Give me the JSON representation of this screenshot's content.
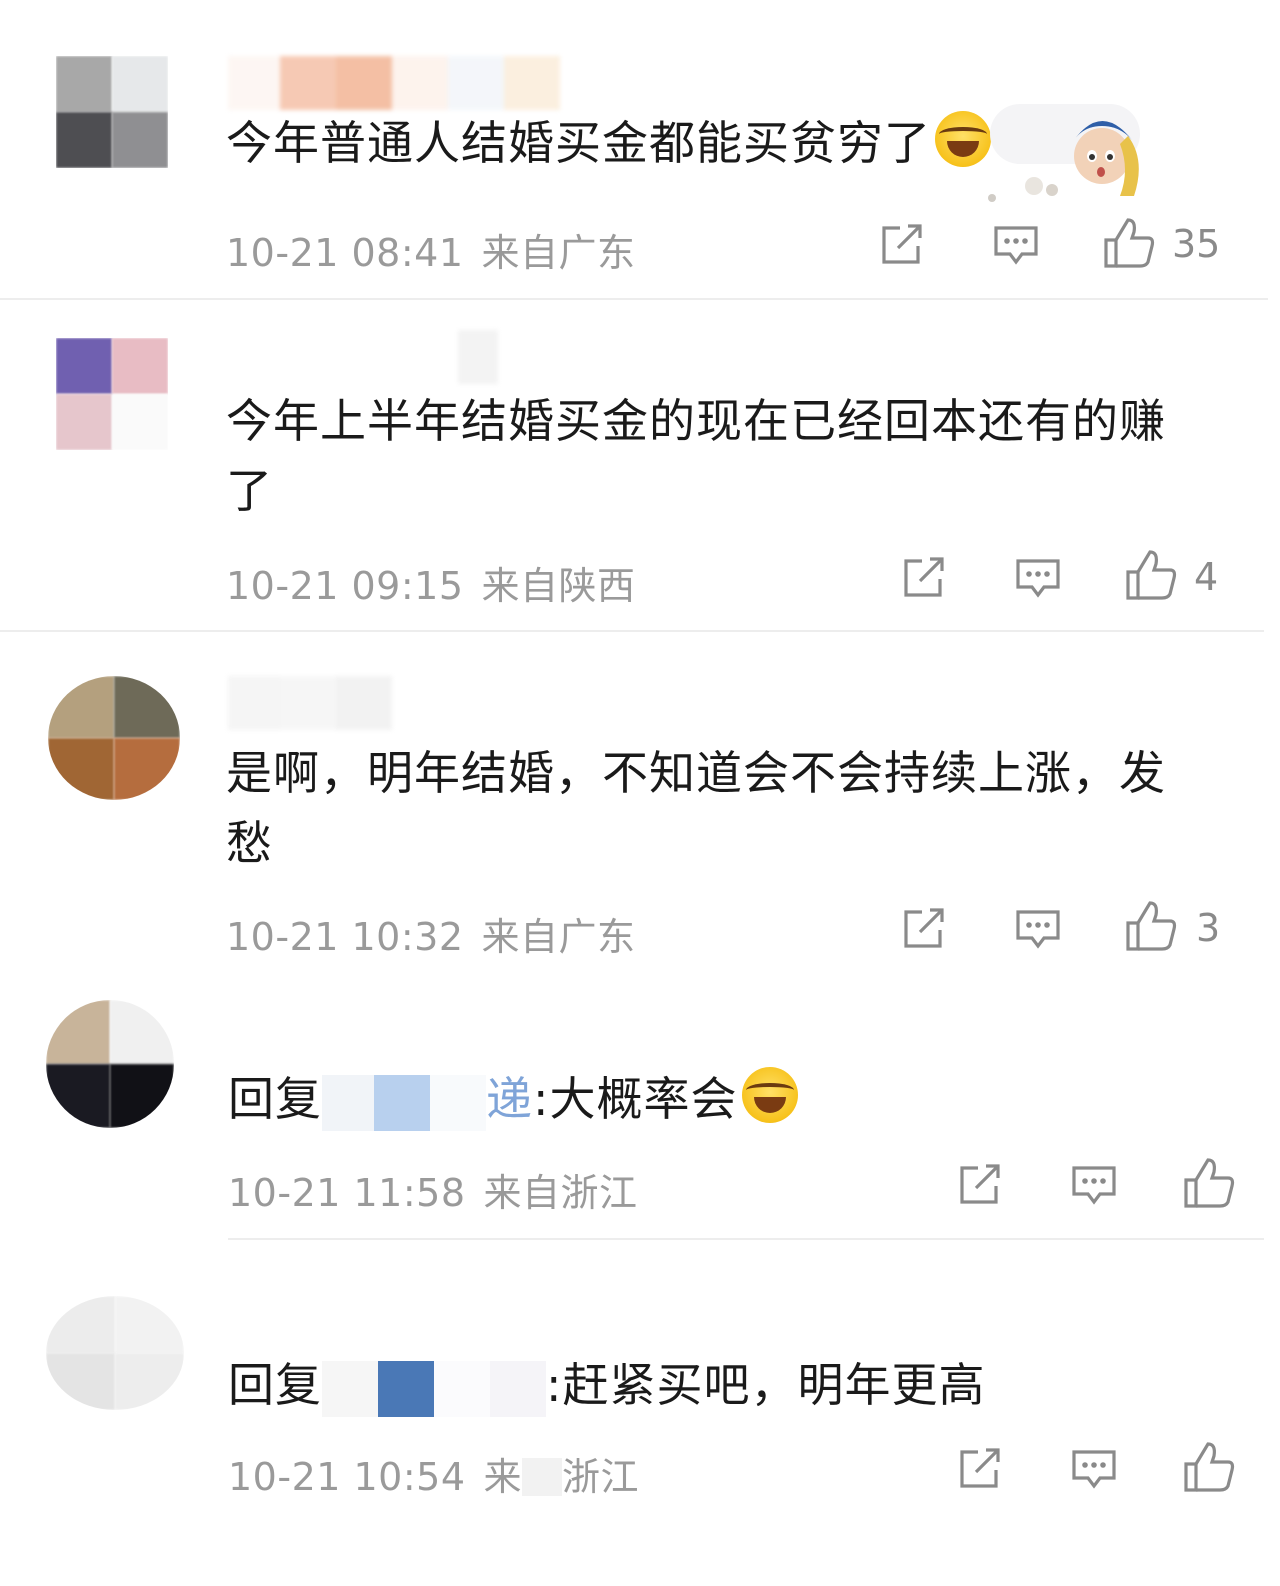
{
  "comments": [
    {
      "text": "今年普通人结婚买金都能买贫穷了",
      "time": "10-21 08:41",
      "location": "来自广东",
      "likes": "35"
    },
    {
      "text_line1": "今年上半年结婚买金的现在已经回本还有的赚",
      "text_line2": "了",
      "time": "10-21 09:15",
      "location": "来自陕西",
      "likes": "4"
    },
    {
      "text_line1": "是啊，明年结婚，不知道会不会持续上涨，发",
      "text_line2": "愁",
      "time": "10-21 10:32",
      "location": "来自广东",
      "likes": "3"
    },
    {
      "reply_prefix": "回复",
      "mention_tail": "递",
      "reply_body": ":大概率会",
      "time": "10-21 11:58",
      "location": "来自浙江",
      "likes": ""
    },
    {
      "reply_prefix": "回复",
      "reply_body": ":赶紧买吧，明年更高",
      "time": "10-21 10:54",
      "location_visible": "来",
      "location_tail": "浙江",
      "likes": ""
    }
  ],
  "icons": [
    "share-icon",
    "comment-icon",
    "like-icon",
    "laugh-cry-emoji",
    "sticker-girl-pearl-earring"
  ],
  "colors": {
    "text": "#1a1a1a",
    "meta": "#9a9a9a",
    "divider": "#ededed",
    "icon": "#8a8a8a"
  }
}
